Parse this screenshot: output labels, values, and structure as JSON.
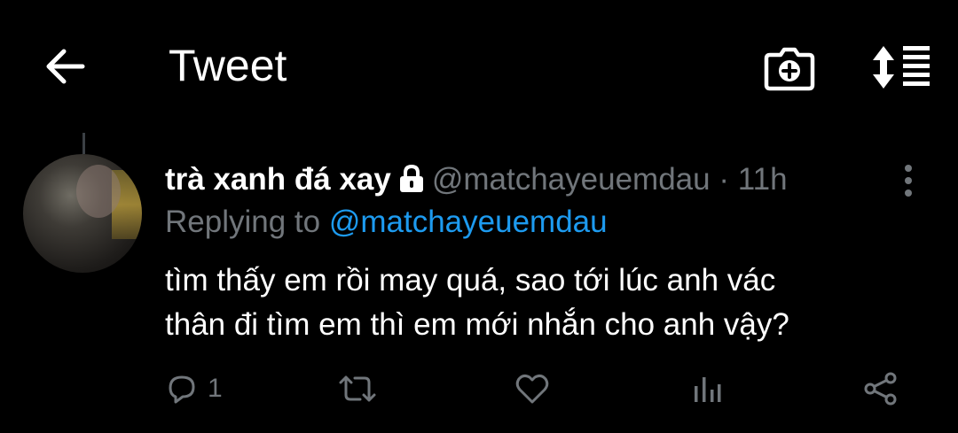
{
  "header": {
    "title": "Tweet",
    "icons": [
      "back-arrow-icon",
      "camera-add-icon",
      "sort-icon"
    ]
  },
  "tweet": {
    "display_name": "trà xanh đá xay",
    "handle": "@matchayeuemdau",
    "separator": "·",
    "time": "11h",
    "replying_prefix": "Replying to",
    "replying_to": "@matchayeuemdau",
    "text_line1": "tìm thấy em rồi may quá, sao tới lúc anh vác",
    "text_line2": "thân đi tìm em thì em mới nhắn cho anh vậy?",
    "reply_count": "1"
  },
  "colors": {
    "background": "#000000",
    "muted": "#71767b",
    "link": "#1d9bf0",
    "text": "#ffffff"
  }
}
